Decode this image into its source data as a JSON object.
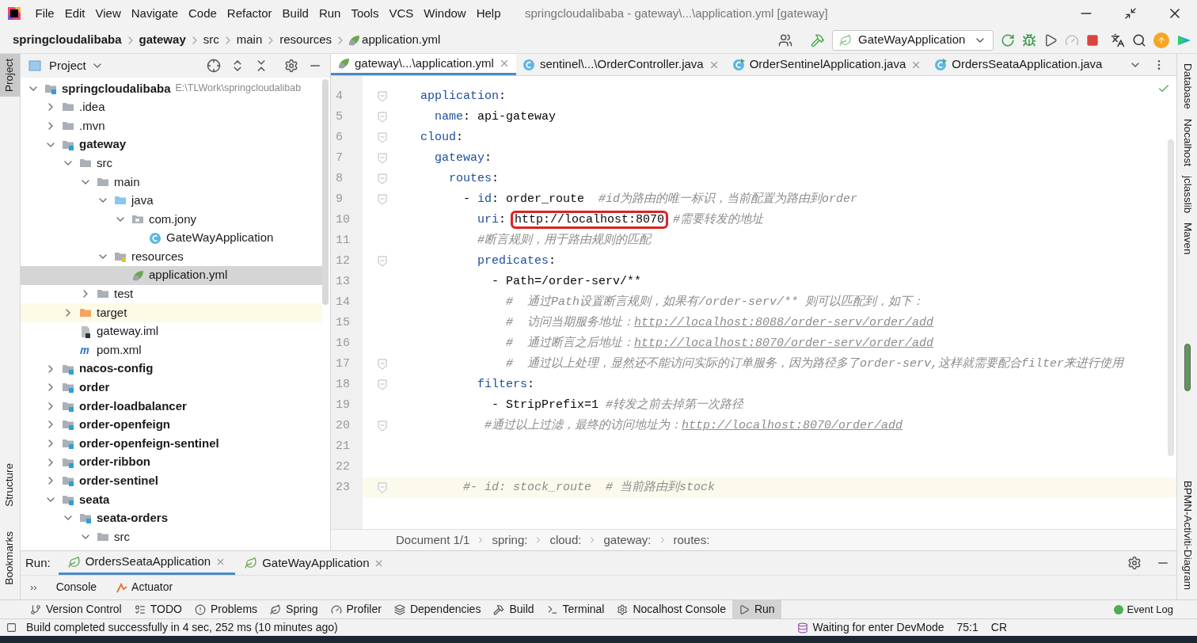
{
  "menu": [
    "File",
    "Edit",
    "View",
    "Navigate",
    "Code",
    "Refactor",
    "Build",
    "Run",
    "Tools",
    "VCS",
    "Window",
    "Help"
  ],
  "window": {
    "title": "springcloudalibaba - gateway\\...\\application.yml [gateway]"
  },
  "breadcrumb": [
    {
      "kind": "module",
      "text": "springcloudalibaba"
    },
    {
      "kind": "module",
      "text": "gateway"
    },
    {
      "kind": "folder",
      "text": "src"
    },
    {
      "kind": "folder",
      "text": "main"
    },
    {
      "kind": "folder",
      "text": "resources"
    },
    {
      "kind": "yml",
      "text": "application.yml"
    }
  ],
  "run_config": "GateWayApplication",
  "left_tabs": [
    {
      "label": "Project",
      "selected": true
    },
    {
      "label": "Structure",
      "selected": false
    },
    {
      "label": "Bookmarks",
      "selected": false
    }
  ],
  "right_tabs": [
    "Database",
    "Nocalhost",
    "jclasslib",
    "Maven",
    "BPMN-Activiti-Diagram"
  ],
  "project": {
    "title": "Project",
    "tree": [
      {
        "kind": "module",
        "name": "springcloudalibaba",
        "path": "E:\\TLWork\\springcloudalibab",
        "expanded": true,
        "selected": false,
        "children": [
          {
            "kind": "folder",
            "name": ".idea",
            "expanded": false,
            "selected": false
          },
          {
            "kind": "folder",
            "name": ".mvn",
            "expanded": false,
            "selected": false
          },
          {
            "kind": "module",
            "name": "gateway",
            "expanded": true,
            "selected": false,
            "children": [
              {
                "kind": "folder",
                "name": "src",
                "expanded": true,
                "selected": false,
                "children": [
                  {
                    "kind": "folder",
                    "name": "main",
                    "expanded": true,
                    "selected": false,
                    "children": [
                      {
                        "kind": "source",
                        "name": "java",
                        "expanded": true,
                        "selected": false,
                        "children": [
                          {
                            "kind": "package",
                            "name": "com.jony",
                            "expanded": true,
                            "selected": false,
                            "children": [
                              {
                                "kind": "class",
                                "name": "GateWayApplication",
                                "selected": false
                              }
                            ]
                          }
                        ]
                      },
                      {
                        "kind": "resources",
                        "name": "resources",
                        "expanded": true,
                        "selected": false,
                        "children": [
                          {
                            "kind": "yml",
                            "name": "application.yml",
                            "selected": true
                          }
                        ]
                      }
                    ]
                  },
                  {
                    "kind": "folder",
                    "name": "test",
                    "expanded": false,
                    "selected": false
                  }
                ]
              },
              {
                "kind": "target",
                "name": "target",
                "expanded": false,
                "selected": false
              },
              {
                "kind": "iml",
                "name": "gateway.iml",
                "selected": false
              },
              {
                "kind": "maven",
                "name": "pom.xml",
                "selected": false
              }
            ]
          },
          {
            "kind": "module",
            "name": "nacos-config",
            "expanded": false,
            "selected": false
          },
          {
            "kind": "module",
            "name": "order",
            "expanded": false,
            "selected": false
          },
          {
            "kind": "module",
            "name": "order-loadbalancer",
            "expanded": false,
            "selected": false
          },
          {
            "kind": "module",
            "name": "order-openfeign",
            "expanded": false,
            "selected": false
          },
          {
            "kind": "module",
            "name": "order-openfeign-sentinel",
            "expanded": false,
            "selected": false
          },
          {
            "kind": "module",
            "name": "order-ribbon",
            "expanded": false,
            "selected": false
          },
          {
            "kind": "module",
            "name": "order-sentinel",
            "expanded": false,
            "selected": false
          },
          {
            "kind": "module",
            "name": "seata",
            "expanded": true,
            "selected": false,
            "children": [
              {
                "kind": "module",
                "name": "seata-orders",
                "expanded": true,
                "selected": false,
                "children": [
                  {
                    "kind": "folder",
                    "name": "src",
                    "expanded": true,
                    "selected": false
                  }
                ]
              }
            ]
          }
        ]
      }
    ]
  },
  "editor": {
    "tabs": [
      {
        "kind": "yml",
        "label": "gateway\\...\\application.yml",
        "selected": true
      },
      {
        "kind": "class",
        "label": "sentinel\\...\\OrderController.java",
        "selected": false
      },
      {
        "kind": "app",
        "label": "OrderSentinelApplication.java",
        "selected": false
      },
      {
        "kind": "app",
        "label": "OrdersSeataApplication.java",
        "selected": false
      }
    ],
    "lines": [
      {
        "number": "4",
        "fold": true,
        "current": false,
        "segments": [
          {
            "kind": "key",
            "text": "  application"
          },
          {
            "kind": "plain",
            "text": ":"
          }
        ]
      },
      {
        "number": "5",
        "fold": true,
        "current": false,
        "segments": [
          {
            "kind": "key",
            "text": "    name"
          },
          {
            "kind": "plain",
            "text": ": api-gateway"
          }
        ]
      },
      {
        "number": "6",
        "fold": true,
        "current": false,
        "segments": [
          {
            "kind": "key",
            "text": "  cloud"
          },
          {
            "kind": "plain",
            "text": ":"
          }
        ]
      },
      {
        "number": "7",
        "fold": true,
        "current": false,
        "segments": [
          {
            "kind": "key",
            "text": "    gateway"
          },
          {
            "kind": "plain",
            "text": ":"
          }
        ]
      },
      {
        "number": "8",
        "fold": true,
        "current": false,
        "segments": [
          {
            "kind": "key",
            "text": "      routes"
          },
          {
            "kind": "plain",
            "text": ":"
          }
        ]
      },
      {
        "number": "9",
        "fold": true,
        "current": false,
        "segments": [
          {
            "kind": "plain",
            "text": "        - "
          },
          {
            "kind": "key",
            "text": "id"
          },
          {
            "kind": "plain",
            "text": ": order_route  "
          },
          {
            "kind": "comment",
            "text": "#id为路由的唯一标识，当前配置为路由到order"
          }
        ]
      },
      {
        "number": "10",
        "fold": false,
        "current": false,
        "segments": [
          {
            "kind": "key",
            "text": "          uri"
          },
          {
            "kind": "plain",
            "text": ": "
          },
          {
            "kind": "boxed",
            "text": "http://localhost:8070"
          },
          {
            "kind": "comment",
            "text": " #需要转发的地址"
          }
        ]
      },
      {
        "number": "11",
        "fold": false,
        "current": false,
        "segments": [
          {
            "kind": "comment",
            "text": "          #断言规则，用于路由规则的匹配"
          }
        ]
      },
      {
        "number": "12",
        "fold": true,
        "current": false,
        "segments": [
          {
            "kind": "key",
            "text": "          predicates"
          },
          {
            "kind": "plain",
            "text": ":"
          }
        ]
      },
      {
        "number": "13",
        "fold": false,
        "current": false,
        "segments": [
          {
            "kind": "plain",
            "text": "            - Path=/order-serv/**"
          }
        ]
      },
      {
        "number": "14",
        "fold": false,
        "current": false,
        "segments": [
          {
            "kind": "comment",
            "text": "              #  通过Path设置断言规则，如果有/order-serv/** 则可以匹配到，如下："
          }
        ]
      },
      {
        "number": "15",
        "fold": false,
        "current": false,
        "segments": [
          {
            "kind": "comment",
            "text": "              #  访问当期服务地址："
          },
          {
            "kind": "link",
            "text": "http://localhost:8088/order-serv/order/add"
          }
        ]
      },
      {
        "number": "16",
        "fold": false,
        "current": false,
        "segments": [
          {
            "kind": "comment",
            "text": "              #  通过断言之后地址："
          },
          {
            "kind": "link",
            "text": "http://localhost:8070/order-serv/order/add"
          }
        ]
      },
      {
        "number": "17",
        "fold": true,
        "current": false,
        "segments": [
          {
            "kind": "comment",
            "text": "              #  通过以上处理，显然还不能访问实际的订单服务，因为路径多了order-serv,这样就需要配合filter来进行使用"
          }
        ]
      },
      {
        "number": "18",
        "fold": true,
        "current": false,
        "segments": [
          {
            "kind": "key",
            "text": "          filters"
          },
          {
            "kind": "plain",
            "text": ":"
          }
        ]
      },
      {
        "number": "19",
        "fold": false,
        "current": false,
        "segments": [
          {
            "kind": "plain",
            "text": "            - StripPrefix=1 "
          },
          {
            "kind": "comment",
            "text": "#转发之前去掉第一次路径"
          }
        ]
      },
      {
        "number": "20",
        "fold": true,
        "current": false,
        "segments": [
          {
            "kind": "comment",
            "text": "           #通过以上过滤，最终的访问地址为："
          },
          {
            "kind": "link",
            "text": "http://localhost:8070/order/add"
          }
        ]
      },
      {
        "number": "21",
        "fold": false,
        "current": false
      },
      {
        "number": "22",
        "fold": false,
        "current": false
      },
      {
        "number": "23",
        "fold": true,
        "current": true,
        "segments": [
          {
            "kind": "comment",
            "text": "        #- id: stock_route  # 当前路由到stock"
          }
        ]
      }
    ],
    "breadcrumb": [
      "Document 1/1",
      "spring:",
      "cloud:",
      "gateway:",
      "routes:"
    ]
  },
  "run_panel": {
    "label": "Run:",
    "tabs": [
      {
        "label": "OrdersSeataApplication",
        "selected": true
      },
      {
        "label": "GateWayApplication",
        "selected": false
      }
    ],
    "more": "››",
    "subtabs": [
      {
        "kind": "console",
        "label": "Console"
      },
      {
        "kind": "actuator",
        "label": "Actuator"
      }
    ]
  },
  "tool_windows": [
    {
      "kind": "vcs",
      "label": "Version Control",
      "selected": false
    },
    {
      "kind": "todo",
      "label": "TODO",
      "selected": false
    },
    {
      "kind": "problems",
      "label": "Problems",
      "selected": false
    },
    {
      "kind": "spring",
      "label": "Spring",
      "selected": false
    },
    {
      "kind": "profiler",
      "label": "Profiler",
      "selected": false
    },
    {
      "kind": "deps",
      "label": "Dependencies",
      "selected": false
    },
    {
      "kind": "build",
      "label": "Build",
      "selected": false
    },
    {
      "kind": "terminal",
      "label": "Terminal",
      "selected": false
    },
    {
      "kind": "nocalhost",
      "label": "Nocalhost Console",
      "selected": false
    },
    {
      "kind": "run",
      "label": "Run",
      "selected": true
    }
  ],
  "event_log": "Event Log",
  "status": {
    "message": "Build completed successfully in 4 sec, 252 ms (10 minutes ago)",
    "devmode": "Waiting for enter DevMode",
    "position": "75:1",
    "line_ending": "CR"
  }
}
